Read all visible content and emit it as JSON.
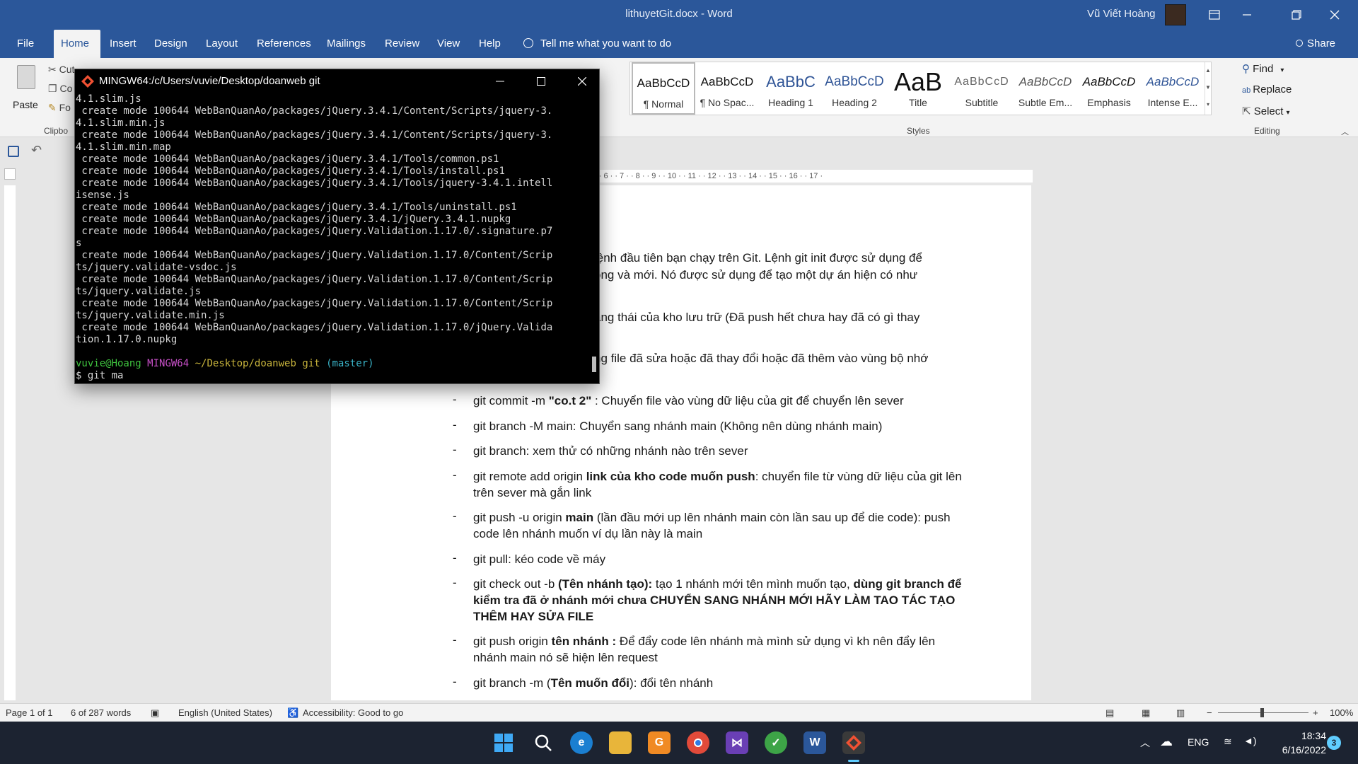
{
  "window": {
    "title": "lithuyetGit.docx  -  Word",
    "user": "Vũ Viết Hoàng"
  },
  "ribbon_tabs": [
    "File",
    "Home",
    "Insert",
    "Design",
    "Layout",
    "References",
    "Mailings",
    "Review",
    "View",
    "Help"
  ],
  "active_tab": "Home",
  "tell_me": "Tell me what you want to do",
  "share_label": "Share",
  "clipboard": {
    "paste_label": "Paste",
    "cut_label": "Cut",
    "copy_label": "Co",
    "format_label": "Fo",
    "group_label": "Clipbo"
  },
  "styles": {
    "group_label": "Styles",
    "items": [
      {
        "sample": "AaBbCcD",
        "name": "¶ Normal"
      },
      {
        "sample": "AaBbCcD",
        "name": "¶ No Spac..."
      },
      {
        "sample": "AaBbC",
        "name": "Heading 1"
      },
      {
        "sample": "AaBbCcD",
        "name": "Heading 2"
      },
      {
        "sample": "AaB",
        "name": "Title"
      },
      {
        "sample": "AaBbCcD",
        "name": "Subtitle"
      },
      {
        "sample": "AaBbCcD",
        "name": "Subtle Em..."
      },
      {
        "sample": "AaBbCcD",
        "name": "Emphasis"
      },
      {
        "sample": "AaBbCcD",
        "name": "Intense E..."
      }
    ]
  },
  "editing": {
    "group_label": "Editing",
    "find_label": "Find",
    "replace_label": "Replace",
    "select_label": "Select"
  },
  "ruler_text": "·  ·  6  ·  ·  7  ·  ·  8  ·  ·  9  ·  ·  10  ·  ·  11  ·  ·  12  ·  ·  13  ·  ·  14  ·  ·  15  ·  ·  16  ·  ·  17  ·",
  "document": {
    "partial_lines": [
      "lệnh đầu tiên bạn chạy trên Git. Lệnh git init được sử dụng để",
      "ông và mới. Nó được sử dụng để tạo một dự án hiện có như",
      "ang thái của kho lưu trữ (Đã push hết chưa hay đã có gì thay",
      "ng file đã sửa hoặc đã thay đổi hoặc đã thêm vào vùng bộ nhớ"
    ],
    "items": [
      {
        "pre": "git commit -m ",
        "bold": "\"co.t 2\"",
        "post": " : Chuyển file vào vùng dữ liệu của git để chuyển lên sever"
      },
      {
        "pre": "git branch -M main: Chuyển sang nhánh main (Không nên dùng nhánh main)",
        "bold": "",
        "post": ""
      },
      {
        "pre": "git branch: xem thử có những nhánh nào trên sever",
        "bold": "",
        "post": ""
      },
      {
        "pre": "git remote add origin ",
        "bold": "link của kho code muốn push",
        "post": ": chuyển file từ vùng dữ liệu của git lên trên sever mà gắn link"
      },
      {
        "pre": "git push -u origin ",
        "bold": "main",
        "post": " (lần đầu mới up lên nhánh main còn lần sau up để die code): push code lên nhánh muốn ví dụ lần này là main"
      },
      {
        "pre": "git pull: kéo code về máy",
        "bold": "",
        "post": ""
      },
      {
        "pre": "git check out -b ",
        "bold": "(Tên nhánh tạo):",
        "post": " tạo 1 nhánh mới tên mình muốn tạo, ",
        "bold2": "dùng git branch để kiểm tra đã ở nhánh mới chưa CHUYỂN SANG NHÁNH MỚI HÃY LÀM TAO TÁC TẠO THÊM HAY SỬA FILE"
      },
      {
        "pre": "git push origin ",
        "bold": "tên nhánh :",
        "post": " Để đẩy code lên nhánh mà mình sử dụng vì kh nên đẩy lên nhánh main nó sẽ hiện lên request"
      },
      {
        "pre": "git branch -m (",
        "bold": "Tên muốn đổi",
        "post": "): đổi tên nhánh"
      }
    ]
  },
  "status": {
    "page": "Page 1 of 1",
    "words": "6 of 287 words",
    "language": "English (United States)",
    "accessibility": "Accessibility: Good to go",
    "zoom": "100%"
  },
  "terminal": {
    "title": "MINGW64:/c/Users/vuvie/Desktop/doanweb git",
    "lines": [
      "4.1.slim.js",
      " create mode 100644 WebBanQuanAo/packages/jQuery.3.4.1/Content/Scripts/jquery-3.",
      "4.1.slim.min.js",
      " create mode 100644 WebBanQuanAo/packages/jQuery.3.4.1/Content/Scripts/jquery-3.",
      "4.1.slim.min.map",
      " create mode 100644 WebBanQuanAo/packages/jQuery.3.4.1/Tools/common.ps1",
      " create mode 100644 WebBanQuanAo/packages/jQuery.3.4.1/Tools/install.ps1",
      " create mode 100644 WebBanQuanAo/packages/jQuery.3.4.1/Tools/jquery-3.4.1.intell",
      "isense.js",
      " create mode 100644 WebBanQuanAo/packages/jQuery.3.4.1/Tools/uninstall.ps1",
      " create mode 100644 WebBanQuanAo/packages/jQuery.3.4.1/jQuery.3.4.1.nupkg",
      " create mode 100644 WebBanQuanAo/packages/jQuery.Validation.1.17.0/.signature.p7",
      "s",
      " create mode 100644 WebBanQuanAo/packages/jQuery.Validation.1.17.0/Content/Scrip",
      "ts/jquery.validate-vsdoc.js",
      " create mode 100644 WebBanQuanAo/packages/jQuery.Validation.1.17.0/Content/Scrip",
      "ts/jquery.validate.js",
      " create mode 100644 WebBanQuanAo/packages/jQuery.Validation.1.17.0/Content/Scrip",
      "ts/jquery.validate.min.js",
      " create mode 100644 WebBanQuanAo/packages/jQuery.Validation.1.17.0/jQuery.Valida",
      "tion.1.17.0.nupkg",
      ""
    ],
    "prompt_user": "vuvie@Hoang",
    "prompt_env": "MINGW64",
    "prompt_path": "~/Desktop/doanweb git",
    "prompt_branch": "(master)",
    "command": "$ git ma"
  },
  "tray": {
    "language": "ENG",
    "time": "18:34",
    "date": "6/16/2022",
    "notifications": "3"
  }
}
